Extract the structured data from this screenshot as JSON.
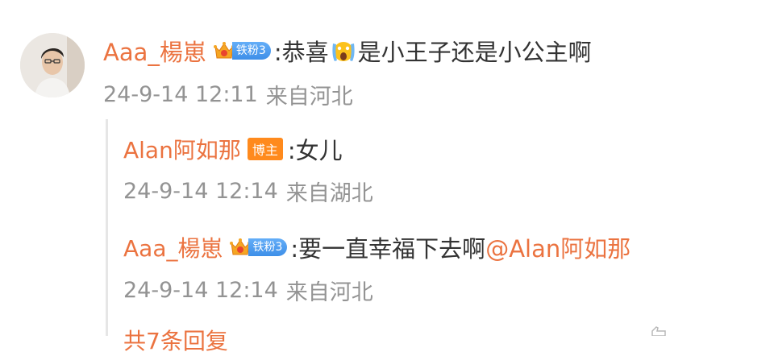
{
  "comment": {
    "username": "Aaa_楊崽",
    "fan_level": "铁粉3",
    "text_before_emoji": ":恭喜",
    "emoji": "scream-emoji",
    "text_after_emoji": "是小王子还是小公主啊",
    "time": "24-9-14 12:11",
    "location": "来自河北"
  },
  "replies": [
    {
      "username": "Alan阿如那",
      "badge": "博主",
      "text": ":女儿",
      "time": "24-9-14 12:14",
      "location": "来自湖北"
    },
    {
      "username": "Aaa_楊崽",
      "fan_level": "铁粉3",
      "text": ":要一直幸福下去啊",
      "mention": "@Alan阿如那",
      "time": "24-9-14 12:14",
      "location": "来自河北"
    }
  ],
  "more_replies": "共7条回复",
  "colors": {
    "username": "#eb7340",
    "text": "#333333",
    "meta": "#939393",
    "fan_badge": "#3e8fe8",
    "blogger_badge": "#ff8a1d"
  }
}
